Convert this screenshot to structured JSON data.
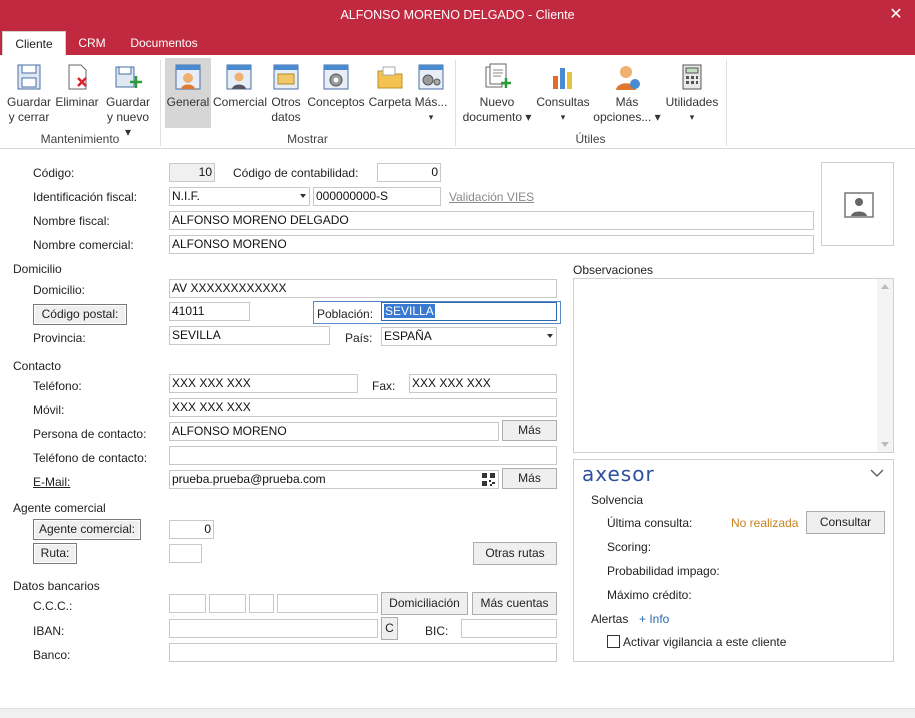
{
  "window": {
    "title": "ALFONSO MORENO DELGADO - Cliente",
    "close": "✕"
  },
  "tabs": [
    "Cliente",
    "CRM",
    "Documentos"
  ],
  "ribbon": {
    "buttons": [
      {
        "l1": "Guardar",
        "l2": "y cerrar"
      },
      {
        "l1": "Eliminar",
        "l2": ""
      },
      {
        "l1": "Guardar",
        "l2": "y nuevo ▾"
      },
      {
        "l1": "General",
        "l2": ""
      },
      {
        "l1": "Comercial",
        "l2": ""
      },
      {
        "l1": "Otros",
        "l2": "datos"
      },
      {
        "l1": "Conceptos",
        "l2": ""
      },
      {
        "l1": "Carpeta",
        "l2": ""
      },
      {
        "l1": "Más...",
        "l2": "▾"
      },
      {
        "l1": "Nuevo",
        "l2": "documento ▾"
      },
      {
        "l1": "Consultas",
        "l2": "▾"
      },
      {
        "l1": "Más",
        "l2": "opciones... ▾"
      },
      {
        "l1": "Utilidades",
        "l2": "▾"
      }
    ],
    "groups": [
      "Mantenimiento",
      "Mostrar",
      "Útiles"
    ]
  },
  "form": {
    "codigo_label": "Código:",
    "codigo": "10",
    "contab_label": "Código de contabilidad:",
    "contab": "0",
    "idfiscal_label": "Identificación fiscal:",
    "idfiscal_tipo": "N.I.F.",
    "idfiscal": "000000000-S",
    "vies": "Validación VIES",
    "nombre_fiscal_label": "Nombre fiscal:",
    "nombre_fiscal": "ALFONSO MORENO DELGADO",
    "nombre_comercial_label": "Nombre comercial:",
    "nombre_comercial": "ALFONSO MORENO",
    "sec_domicilio": "Domicilio",
    "domicilio_label": "Domicilio:",
    "domicilio": "AV XXXXXXXXXXXX",
    "cp_button": "Código postal:",
    "cp": "41011",
    "poblacion_label": "Población:",
    "poblacion": "SEVILLA",
    "provincia_label": "Provincia:",
    "provincia": "SEVILLA",
    "pais_label": "País:",
    "pais": "ESPAÑA",
    "sec_contacto": "Contacto",
    "telefono_label": "Teléfono:",
    "telefono": "XXX XXX XXX",
    "fax_label": "Fax:",
    "fax": "XXX XXX XXX",
    "movil_label": "Móvil:",
    "movil": "XXX XXX XXX",
    "persona_label": "Persona de contacto:",
    "persona": "ALFONSO MORENO",
    "mas1": "Más",
    "tel_contacto_label": "Teléfono de contacto:",
    "tel_contacto": "",
    "email_label": "E-Mail:",
    "email": "prueba.prueba@prueba.com",
    "mas2": "Más",
    "sec_agente": "Agente comercial",
    "agente_button": "Agente comercial:",
    "agente": "0",
    "ruta_button": "Ruta:",
    "ruta": "",
    "otras_rutas": "Otras rutas",
    "sec_bancarios": "Datos bancarios",
    "ccc_label": "C.C.C.:",
    "domiciliacion": "Domiciliación",
    "mas_cuentas": "Más cuentas",
    "iban_label": "IBAN:",
    "iban_c": "C",
    "bic_label": "BIC:",
    "banco_label": "Banco:"
  },
  "observaciones": {
    "label": "Observaciones",
    "text": ""
  },
  "axesor": {
    "logo": "axesor",
    "solvencia": "Solvencia",
    "ultima_label": "Última consulta:",
    "ultima": "No realizada",
    "consultar": "Consultar",
    "scoring": "Scoring:",
    "probabilidad": "Probabilidad impago:",
    "maximo": "Máximo crédito:",
    "alertas": "Alertas",
    "info": "+ Info",
    "vigilancia": "Activar vigilancia a este cliente"
  },
  "colors": {
    "title_bar": "#c0293f",
    "axesor_blue": "#2d4f9e",
    "orange": "#c8811e"
  }
}
